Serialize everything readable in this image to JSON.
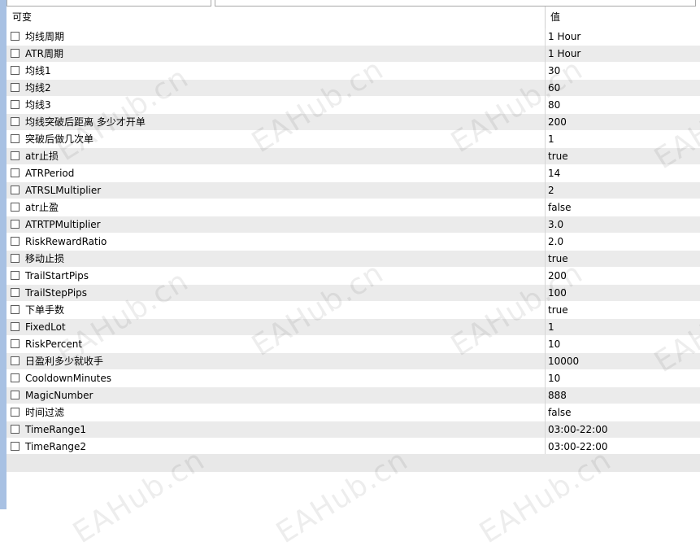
{
  "header": {
    "variable_label": "可变",
    "value_label": "值"
  },
  "params": [
    {
      "name": "均线周期",
      "value": "1 Hour"
    },
    {
      "name": "ATR周期",
      "value": "1 Hour"
    },
    {
      "name": "均线1",
      "value": "30"
    },
    {
      "name": "均线2",
      "value": "60"
    },
    {
      "name": "均线3",
      "value": "80"
    },
    {
      "name": "均线突破后距离 多少才开单",
      "value": "200"
    },
    {
      "name": "突破后做几次单",
      "value": "1"
    },
    {
      "name": "atr止损",
      "value": "true"
    },
    {
      "name": "ATRPeriod",
      "value": "14"
    },
    {
      "name": "ATRSLMultiplier",
      "value": "2"
    },
    {
      "name": "atr止盈",
      "value": "false"
    },
    {
      "name": "ATRTPMultiplier",
      "value": "3.0"
    },
    {
      "name": "RiskRewardRatio",
      "value": "2.0"
    },
    {
      "name": "移动止损",
      "value": "true"
    },
    {
      "name": "TrailStartPips",
      "value": "200"
    },
    {
      "name": "TrailStepPips",
      "value": "100"
    },
    {
      "name": "下单手数",
      "value": "true"
    },
    {
      "name": "FixedLot",
      "value": "1"
    },
    {
      "name": "RiskPercent",
      "value": "10"
    },
    {
      "name": "日盈利多少就收手",
      "value": "10000"
    },
    {
      "name": "CooldownMinutes",
      "value": "10"
    },
    {
      "name": "MagicNumber",
      "value": "888"
    },
    {
      "name": "时间过滤",
      "value": "false"
    },
    {
      "name": "TimeRange1",
      "value": "03:00-22:00"
    },
    {
      "name": "TimeRange2",
      "value": "03:00-22:00"
    }
  ],
  "watermark": "EAHub.cn"
}
